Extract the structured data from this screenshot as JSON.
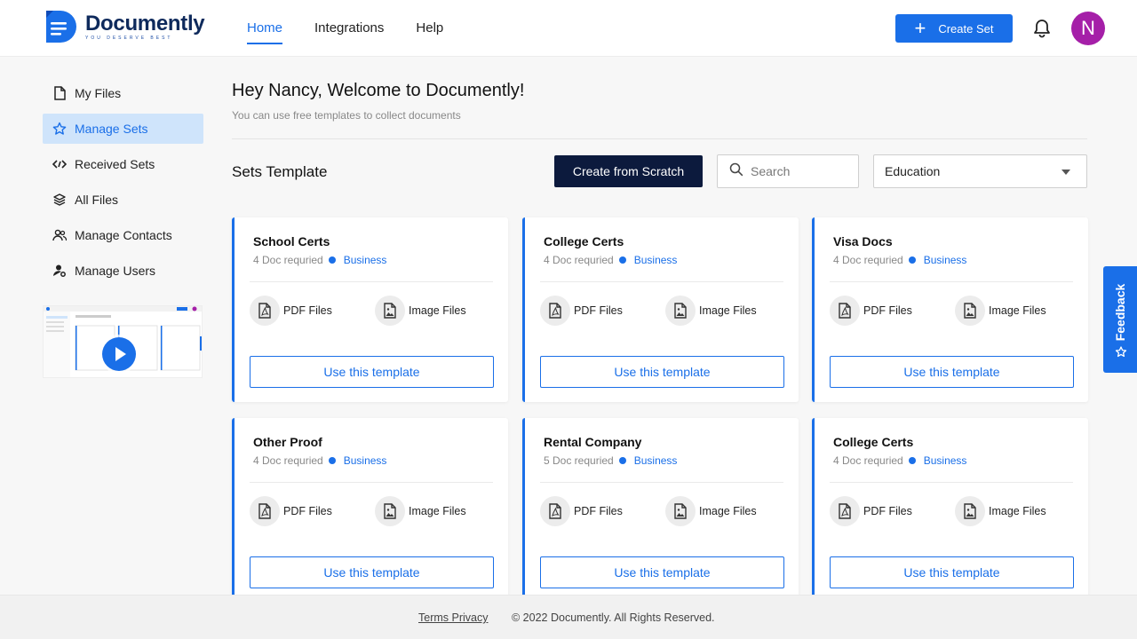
{
  "brand": {
    "name": "Documently",
    "tagline": "YOU DESERVE BEST",
    "color": "#1a6fe8",
    "navy": "#0e2a5c"
  },
  "header": {
    "nav": [
      {
        "label": "Home",
        "active": true
      },
      {
        "label": "Integrations",
        "active": false
      },
      {
        "label": "Help",
        "active": false
      }
    ],
    "create_set_label": "Create Set",
    "avatar_initial": "N",
    "avatar_color": "#a51fa8"
  },
  "sidebar": {
    "items": [
      {
        "label": "My Files",
        "icon": "file-icon",
        "active": false
      },
      {
        "label": "Manage Sets",
        "icon": "star-icon",
        "active": true
      },
      {
        "label": "Received Sets",
        "icon": "code-icon",
        "active": false
      },
      {
        "label": "All Files",
        "icon": "layers-icon",
        "active": false
      },
      {
        "label": "Manage Contacts",
        "icon": "users-icon",
        "active": false
      },
      {
        "label": "Manage Users",
        "icon": "user-gear-icon",
        "active": false
      }
    ]
  },
  "main": {
    "welcome": "Hey Nancy, Welcome to Documently!",
    "subtitle": "You can use free templates to collect documents",
    "sets_title": "Sets Template",
    "scratch_label": "Create from Scratch",
    "search_placeholder": "Search",
    "category_selected": "Education"
  },
  "cards": [
    {
      "title": "School Certs",
      "docs": "4 Doc requried",
      "category": "Business",
      "pdf": "PDF Files",
      "image": "Image Files",
      "button": "Use this template"
    },
    {
      "title": "College Certs",
      "docs": "4 Doc requried",
      "category": "Business",
      "pdf": "PDF Files",
      "image": "Image Files",
      "button": "Use this template"
    },
    {
      "title": "Visa Docs",
      "docs": "4 Doc requried",
      "category": "Business",
      "pdf": "PDF Files",
      "image": "Image Files",
      "button": "Use this template"
    },
    {
      "title": "Other Proof",
      "docs": "4 Doc requried",
      "category": "Business",
      "pdf": "PDF Files",
      "image": "Image Files",
      "button": "Use this template"
    },
    {
      "title": "Rental Company",
      "docs": "5 Doc requried",
      "category": "Business",
      "pdf": "PDF Files",
      "image": "Image Files",
      "button": "Use this template"
    },
    {
      "title": "College Certs",
      "docs": "4 Doc requried",
      "category": "Business",
      "pdf": "PDF Files",
      "image": "Image Files",
      "button": "Use this template"
    }
  ],
  "feedback_label": "Feedback",
  "footer": {
    "links": "Terms Privacy",
    "copyright": "© 2022 Documently. All Rights Reserved."
  }
}
